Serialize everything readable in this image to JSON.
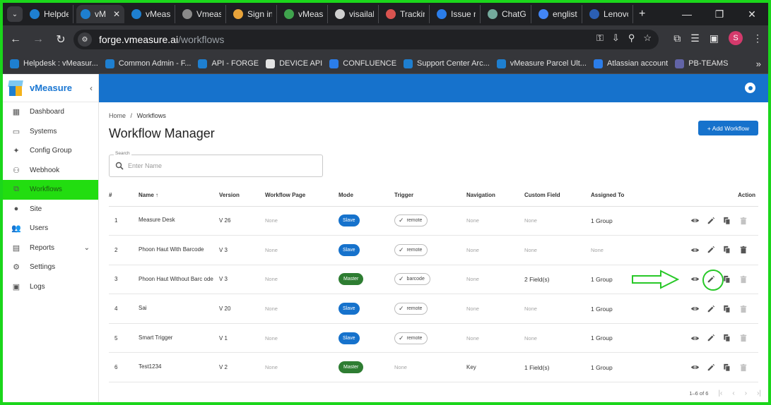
{
  "browser": {
    "tabs": [
      {
        "title": "Helpde",
        "color": "#1e7fd0",
        "active": false
      },
      {
        "title": "vM",
        "color": "#1e7fd0",
        "active": true
      },
      {
        "title": "vMeas",
        "color": "#1e7fd0",
        "active": false
      },
      {
        "title": "Vmeas",
        "color": "#8a8a8a",
        "active": false
      },
      {
        "title": "Sign in",
        "color": "#e8a33a",
        "active": false
      },
      {
        "title": "vMeas",
        "color": "#3fa34d",
        "active": false
      },
      {
        "title": "visailab",
        "color": "#cfcfcf",
        "active": false
      },
      {
        "title": "Trackin",
        "color": "#d9534f",
        "active": false
      },
      {
        "title": "Issue n",
        "color": "#2b7de9",
        "active": false
      },
      {
        "title": "ChatGl",
        "color": "#74aa9c",
        "active": false
      },
      {
        "title": "englist",
        "color": "#4285f4",
        "active": false
      },
      {
        "title": "Lenovo",
        "color": "#2b5fb4",
        "active": false
      }
    ],
    "url_host": "forge.vmeasure.ai",
    "url_path": "/workflows",
    "profile_initial": "S",
    "bookmarks": [
      {
        "label": "Helpdesk : vMeasur...",
        "color": "#1e7fd0"
      },
      {
        "label": "Common Admin - F...",
        "color": "#1e7fd0"
      },
      {
        "label": "API - FORGE",
        "color": "#1e7fd0"
      },
      {
        "label": "DEVICE API",
        "color": "#e3e3e3"
      },
      {
        "label": "CONFLUENCE",
        "color": "#2b7de9"
      },
      {
        "label": "Support Center Arc...",
        "color": "#1e7fd0"
      },
      {
        "label": "vMeasure Parcel Ult...",
        "color": "#1e7fd0"
      },
      {
        "label": "Atlassian account",
        "color": "#2b7de9"
      },
      {
        "label": "PB-TEAMS",
        "color": "#6264a7"
      }
    ]
  },
  "app": {
    "brand": "vMeasure",
    "accent": "#1672cc",
    "menu": [
      {
        "label": "Dashboard",
        "icon": "dashboard-icon",
        "active": false
      },
      {
        "label": "Systems",
        "icon": "systems-icon",
        "active": false
      },
      {
        "label": "Config Group",
        "icon": "config-group-icon",
        "active": false
      },
      {
        "label": "Webhook",
        "icon": "webhook-icon",
        "active": false
      },
      {
        "label": "Workflows",
        "icon": "workflows-icon",
        "active": true
      },
      {
        "label": "Site",
        "icon": "site-icon",
        "active": false
      },
      {
        "label": "Users",
        "icon": "users-icon",
        "active": false
      },
      {
        "label": "Reports",
        "icon": "reports-icon",
        "active": false,
        "expandable": true
      },
      {
        "label": "Settings",
        "icon": "settings-icon",
        "active": false
      },
      {
        "label": "Logs",
        "icon": "logs-icon",
        "active": false
      }
    ]
  },
  "page": {
    "breadcrumb_home": "Home",
    "breadcrumb_sep": "/",
    "breadcrumb_current": "Workflows",
    "title": "Workflow Manager",
    "add_button": "+ Add Workflow",
    "search_label": "Search",
    "search_placeholder": "Enter Name"
  },
  "table": {
    "columns": [
      "#",
      "Name",
      "Version",
      "Workflow Page",
      "Mode",
      "Trigger",
      "Navigation",
      "Custom Field",
      "Assigned To",
      "Action"
    ],
    "sort_indicator": "↑",
    "rows": [
      {
        "num": "1",
        "name": "Measure Desk",
        "version": "V 26",
        "workflow_page": "None",
        "mode": "Slave",
        "trigger": "remote",
        "navigation": "None",
        "custom_field": "None",
        "assigned_to": "1 Group",
        "delete_enabled": false
      },
      {
        "num": "2",
        "name": "Phoon Haut With Barcode",
        "version": "V 3",
        "workflow_page": "None",
        "mode": "Slave",
        "trigger": "remote",
        "navigation": "None",
        "custom_field": "None",
        "assigned_to": "None",
        "delete_enabled": true
      },
      {
        "num": "3",
        "name": "Phoon Haut Without Barc ode",
        "version": "V 3",
        "workflow_page": "None",
        "mode": "Master",
        "trigger": "barcode",
        "navigation": "None",
        "custom_field": "2 Field(s)",
        "assigned_to": "1 Group",
        "delete_enabled": false
      },
      {
        "num": "4",
        "name": "Sai",
        "version": "V 20",
        "workflow_page": "None",
        "mode": "Slave",
        "trigger": "remote",
        "navigation": "None",
        "custom_field": "None",
        "assigned_to": "1 Group",
        "delete_enabled": false
      },
      {
        "num": "5",
        "name": "Smart Trigger",
        "version": "V 1",
        "workflow_page": "None",
        "mode": "Slave",
        "trigger": "remote",
        "navigation": "None",
        "custom_field": "None",
        "assigned_to": "1 Group",
        "delete_enabled": false
      },
      {
        "num": "6",
        "name": "Test1234",
        "version": "V 2",
        "workflow_page": "None",
        "mode": "Master",
        "trigger": "None",
        "navigation": "Key",
        "custom_field": "1 Field(s)",
        "assigned_to": "1 Group",
        "delete_enabled": false
      }
    ],
    "pagination": "1–6 of 6"
  }
}
